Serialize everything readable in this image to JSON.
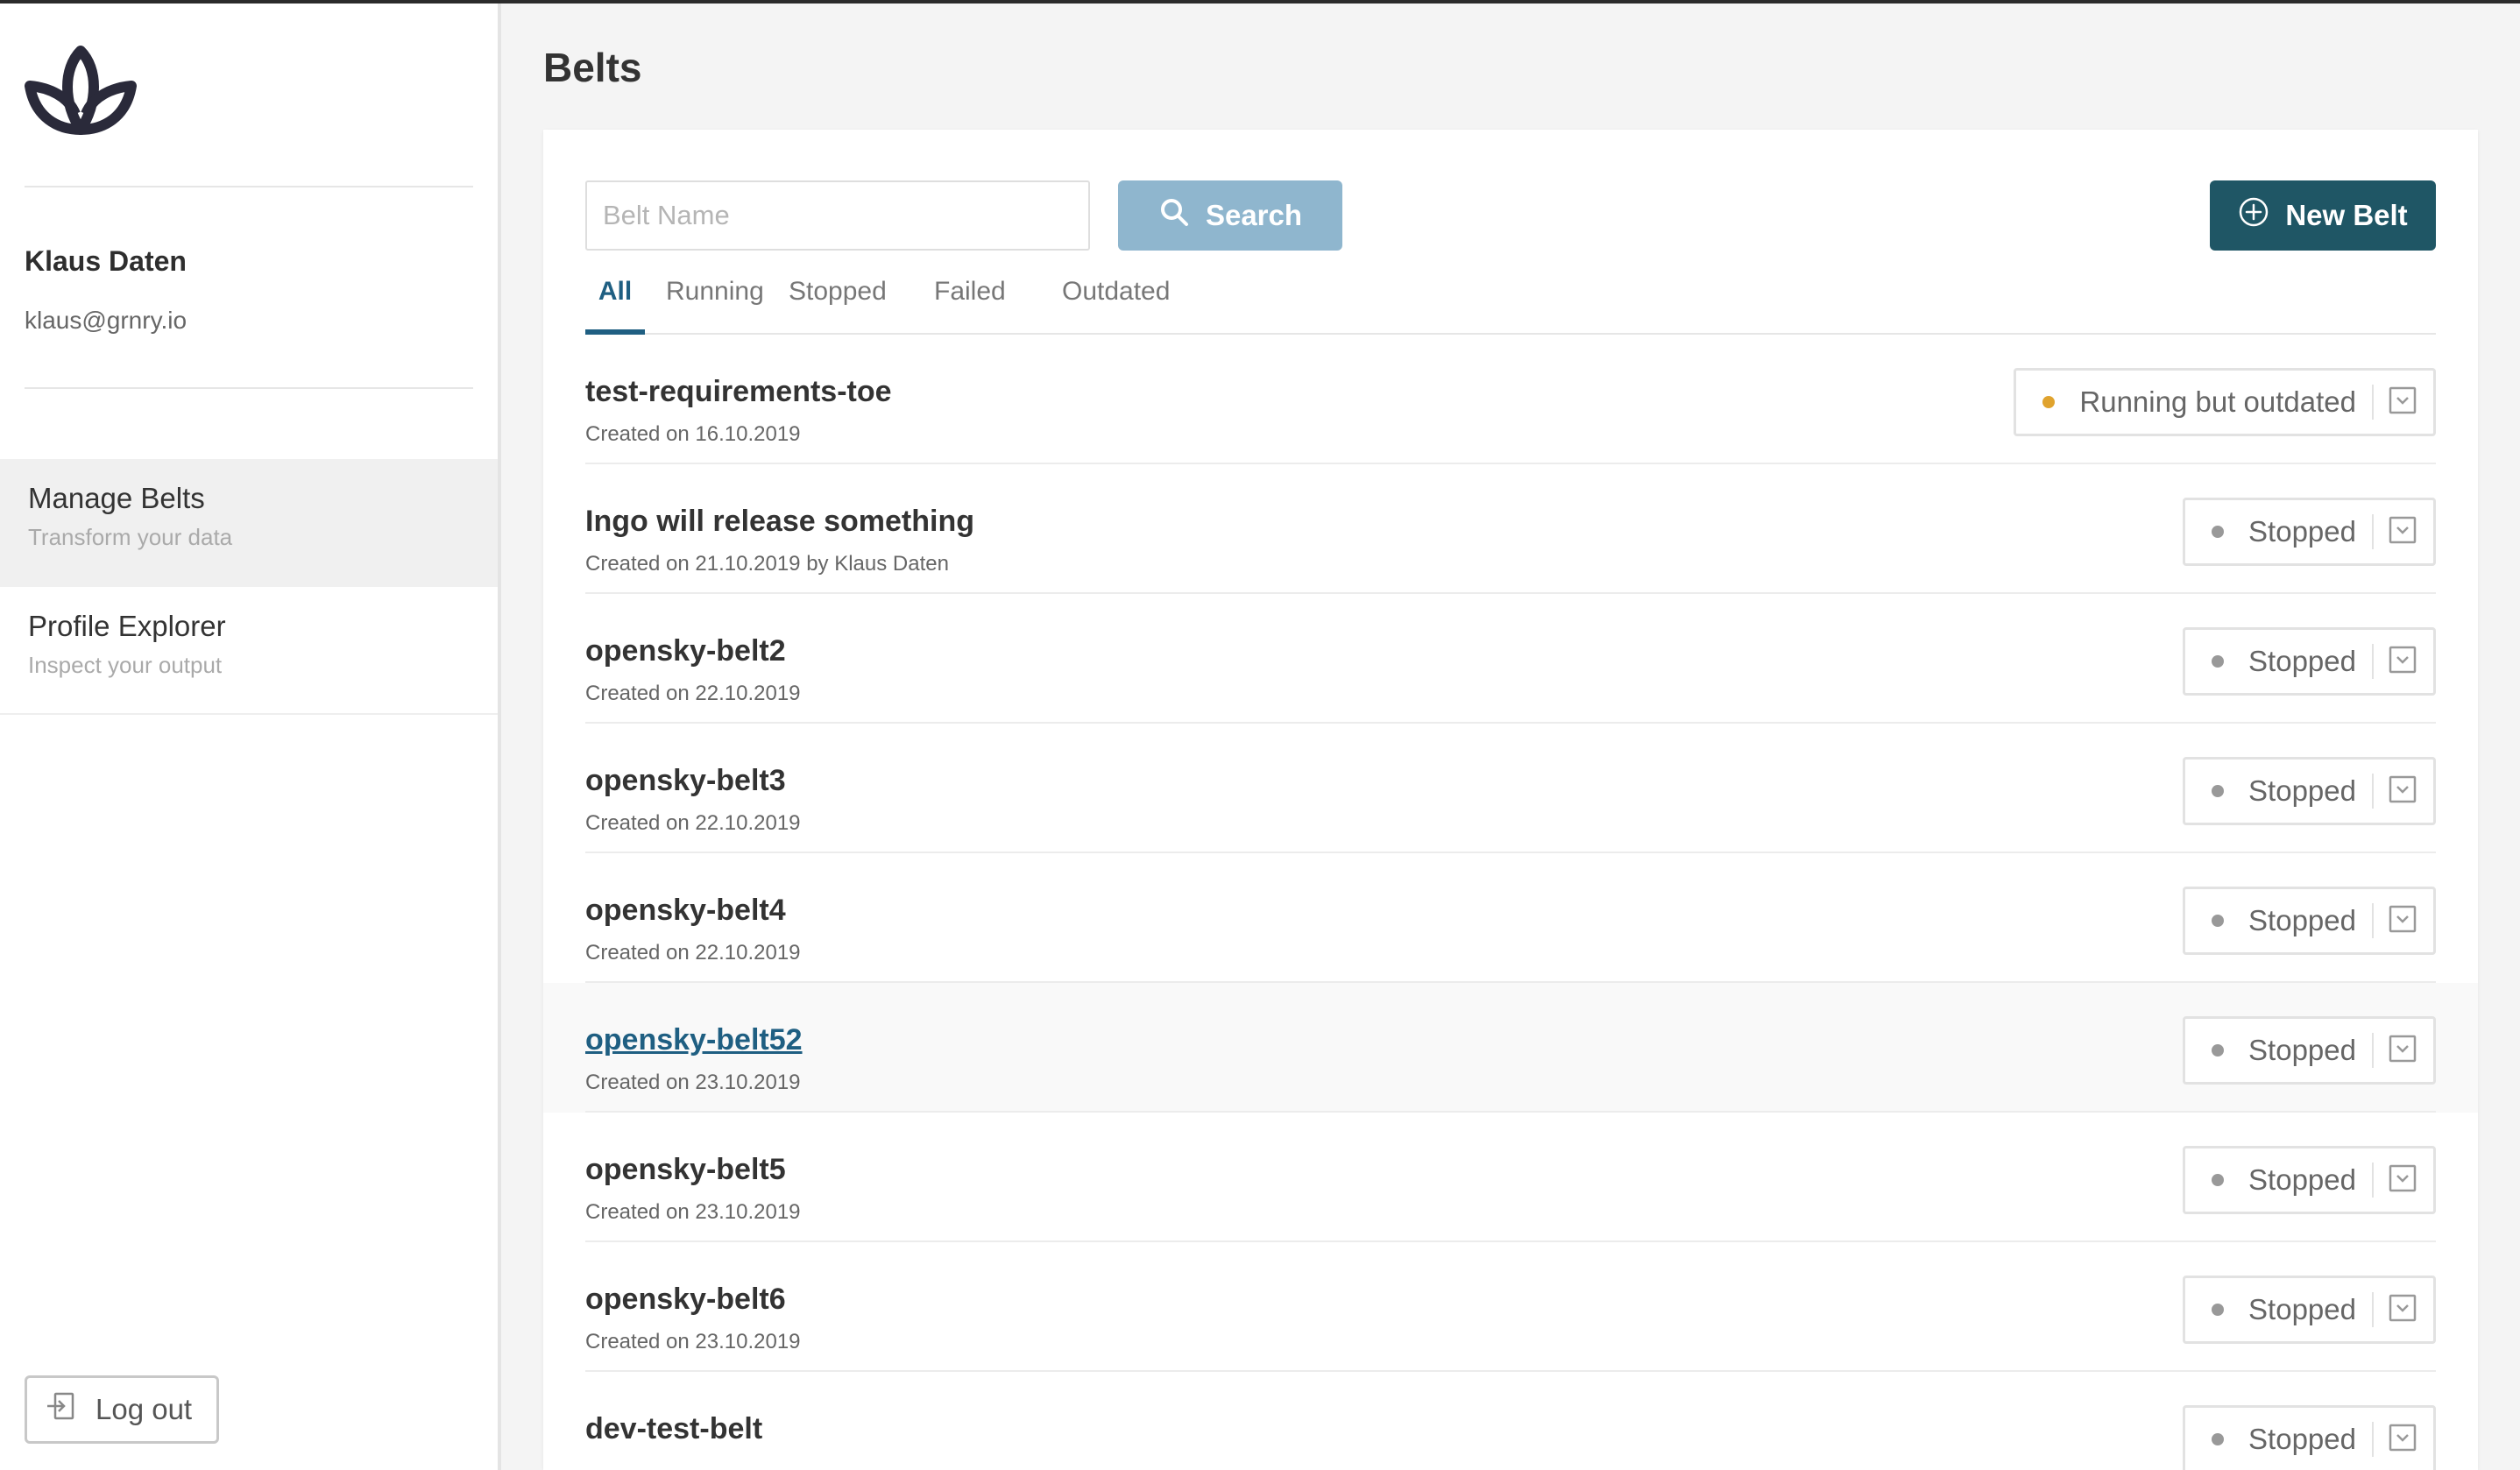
{
  "user": {
    "name": "Klaus Daten",
    "email": "klaus@grnry.io"
  },
  "nav": [
    {
      "title": "Manage Belts",
      "subtitle": "Transform your data"
    },
    {
      "title": "Profile Explorer",
      "subtitle": "Inspect your output"
    }
  ],
  "logout_label": "Log out",
  "page_title": "Belts",
  "search": {
    "placeholder": "Belt Name",
    "value": "",
    "button_label": "Search"
  },
  "new_belt_label": "New Belt",
  "tabs": [
    "All",
    "Running",
    "Stopped",
    "Failed",
    "Outdated"
  ],
  "belts": [
    {
      "name": "test-requirements-toe",
      "meta": "Created on 16.10.2019",
      "status": "Running but outdated"
    },
    {
      "name": "Ingo will release something",
      "meta": "Created on 21.10.2019 by Klaus Daten",
      "status": "Stopped"
    },
    {
      "name": "opensky-belt2",
      "meta": "Created on 22.10.2019",
      "status": "Stopped"
    },
    {
      "name": "opensky-belt3",
      "meta": "Created on 22.10.2019",
      "status": "Stopped"
    },
    {
      "name": "opensky-belt4",
      "meta": "Created on 22.10.2019",
      "status": "Stopped"
    },
    {
      "name": "opensky-belt52",
      "meta": "Created on 23.10.2019",
      "status": "Stopped"
    },
    {
      "name": "opensky-belt5",
      "meta": "Created on 23.10.2019",
      "status": "Stopped"
    },
    {
      "name": "opensky-belt6",
      "meta": "Created on 23.10.2019",
      "status": "Stopped"
    },
    {
      "name": "dev-test-belt",
      "meta": "",
      "status": "Stopped"
    }
  ],
  "colors": {
    "accent": "#1f5f82",
    "primary_button": "#1f5665",
    "search_button": "#8fb6ce",
    "status_outdated": "#e0a32e",
    "status_stopped": "#999999"
  },
  "icons": {
    "logo": "lotus-logo-icon",
    "search": "search-icon",
    "new": "plus-circle-icon",
    "logout": "logout-icon",
    "status_menu": "chevron-down-icon"
  }
}
